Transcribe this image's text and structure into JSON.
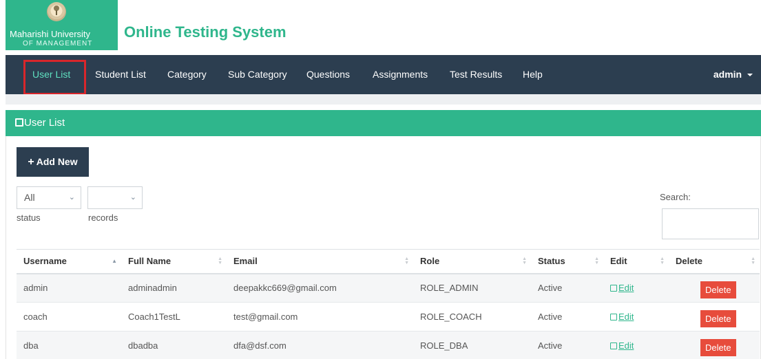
{
  "brand": {
    "university_name": "Maharishi University",
    "university_sub": "OF MANAGEMENT",
    "app_title": "Online Testing System"
  },
  "navbar": {
    "items": [
      {
        "label": "User List"
      },
      {
        "label": "Student List"
      },
      {
        "label": "Category"
      },
      {
        "label": "Sub Category"
      },
      {
        "label": "Questions"
      },
      {
        "label": "Assignments"
      },
      {
        "label": "Test Results"
      },
      {
        "label": "Help"
      }
    ],
    "active": "User List",
    "user_label": "admin"
  },
  "panel": {
    "title": "User List",
    "add_new_label": "Add New"
  },
  "filters": {
    "status_value": "All",
    "status_caption": "status",
    "records_value": "",
    "records_caption": "records",
    "search_label": "Search:",
    "search_value": ""
  },
  "table": {
    "headers": [
      "Username",
      "Full Name",
      "Email",
      "Role",
      "Status",
      "Edit",
      "Delete"
    ],
    "rows": [
      {
        "username": "admin",
        "full_name": "adminadmin",
        "email": "deepakkc669@gmail.com",
        "role": "ROLE_ADMIN",
        "status": "Active",
        "edit": "Edit",
        "delete": "Delete"
      },
      {
        "username": "coach",
        "full_name": "Coach1TestL",
        "email": "test@gmail.com",
        "role": "ROLE_COACH",
        "status": "Active",
        "edit": "Edit",
        "delete": "Delete"
      },
      {
        "username": "dba",
        "full_name": "dbadba",
        "email": "dfa@dsf.com",
        "role": "ROLE_DBA",
        "status": "Active",
        "edit": "Edit",
        "delete": "Delete"
      }
    ]
  },
  "colors": {
    "brand_green": "#2fb68c",
    "navbar_bg": "#2c3e50",
    "active_highlight": "#d9262b",
    "delete_red": "#e74c3c"
  },
  "icons": {
    "seal": "university-seal-icon",
    "panel": "edit-icon",
    "add": "plus-icon",
    "dropdown": "chevron-down-icon",
    "sort": "sort-icon",
    "user_menu": "caret-down-icon"
  }
}
